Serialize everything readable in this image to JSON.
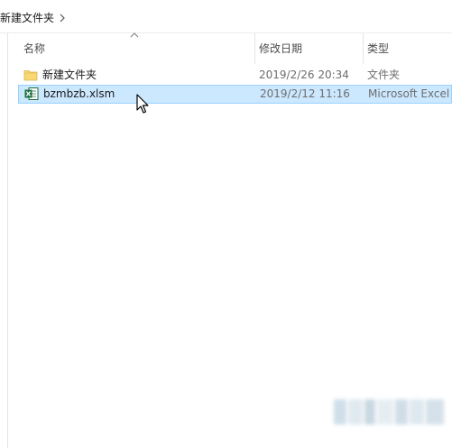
{
  "breadcrumb": {
    "current_folder": "新建文件夹",
    "chevron_icon": "chevron-right-icon"
  },
  "columns": {
    "name": "名称",
    "date_modified": "修改日期",
    "type": "类型",
    "sort_indicator_icon": "sort-ascending-icon"
  },
  "files": [
    {
      "icon": "folder-icon",
      "name": "新建文件夹",
      "date_modified": "2019/2/26 20:34",
      "type": "文件夹",
      "selected": false
    },
    {
      "icon": "excel-file-icon",
      "name": "bzmbzb.xlsm",
      "date_modified": "2019/2/12 11:16",
      "type": "Microsoft Excel",
      "selected": true
    }
  ],
  "cursor_icon": "mouse-pointer-icon",
  "colors": {
    "selection_background": "#cce8ff",
    "selection_border": "#99d1ff",
    "folder_yellow": "#f8d775",
    "excel_green": "#1d7044"
  }
}
